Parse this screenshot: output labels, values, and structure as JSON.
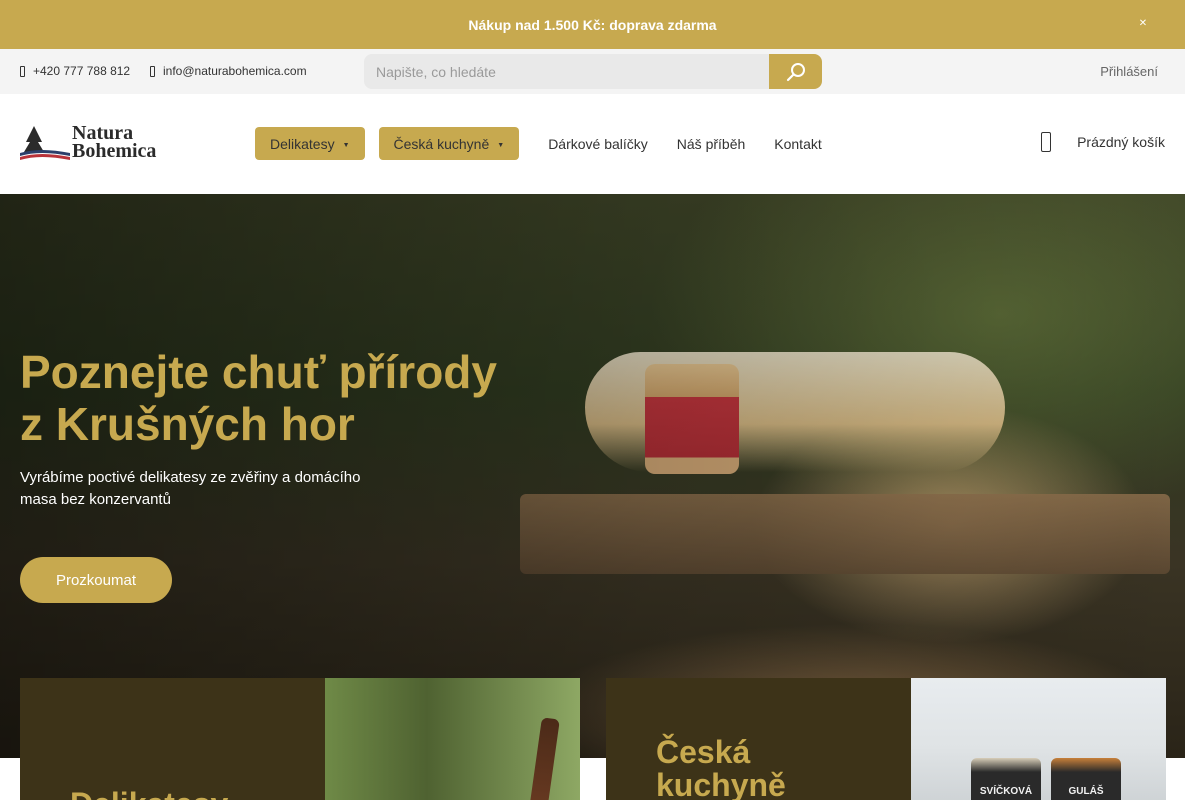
{
  "promo": {
    "text": "Nákup nad 1.500 Kč: doprava zdarma",
    "close_icon": "close-icon"
  },
  "topbar": {
    "phone": "+420 777 788 812",
    "email": "info@naturabohemica.com",
    "search_placeholder": "Napište, co hledáte",
    "login": "Přihlášení"
  },
  "header": {
    "logo_line1": "Natura",
    "logo_line2": "Bohemica",
    "nav": {
      "delikatesy": "Delikatesy",
      "ceska_kuchyne": "Česká kuchyně",
      "darkove_balicky": "Dárkové balíčky",
      "nas_pribeh": "Náš příběh",
      "kontakt": "Kontakt"
    },
    "cart": "Prázdný košík"
  },
  "hero": {
    "title_line1": "Poznejte chuť přírody",
    "title_line2": "z Krušných hor",
    "subtitle": "Vyrábíme poctivé delikatesy ze zvěřiny a domácího masa bez konzervantů",
    "cta": "Prozkoumat"
  },
  "categories": [
    {
      "title": "Delikatesy"
    },
    {
      "title_line1": "Česká",
      "title_line2": "kuchyně",
      "jar_a": "SVÍČKOVÁ",
      "jar_b": "GULÁŠ"
    }
  ],
  "colors": {
    "accent": "#c7a94f",
    "card_bg": "#3d3318",
    "topbar_bg": "#f4f4f4"
  }
}
